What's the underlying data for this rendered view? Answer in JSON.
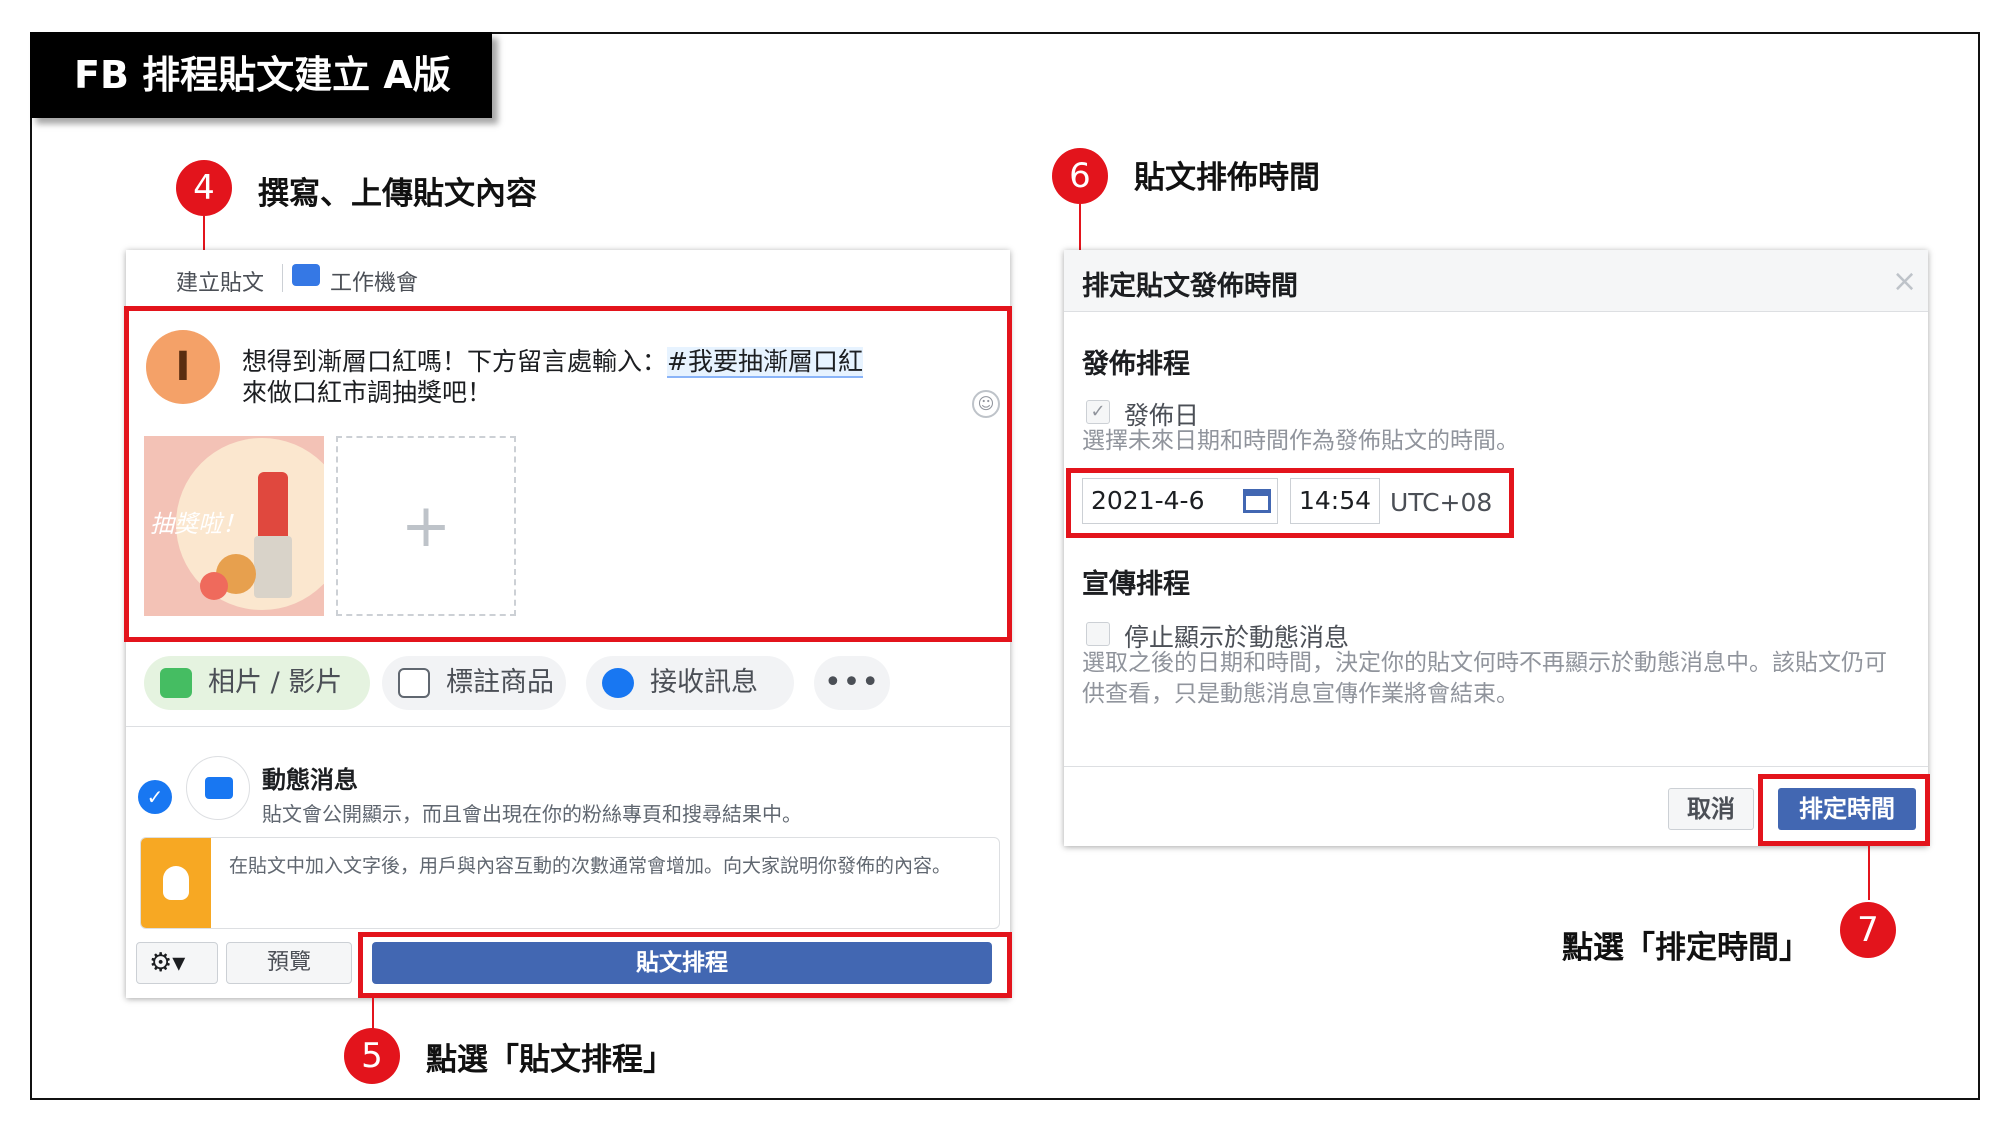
{
  "title": "FB 排程貼文建立 A版",
  "annotations": {
    "step4": {
      "number": "4",
      "text": "撰寫、上傳貼文內容"
    },
    "step5": {
      "number": "5",
      "text": "點選「貼文排程」"
    },
    "step6": {
      "number": "6",
      "text": "貼文排佈時間"
    },
    "step7": {
      "number": "7",
      "text": "點選「排定時間」"
    }
  },
  "composer": {
    "tabs": [
      "建立貼文",
      "工作機會"
    ],
    "avatar_initial": "I",
    "post_text": "想得到漸層口紅嗎！下方留言處輸入：",
    "post_hashtag": "#我要抽漸層口紅",
    "post_text_2": "來做口紅市調抽獎吧！",
    "image_text": "抽獎啦！",
    "add_media": "+",
    "actions": {
      "photos": "相片 / 影片",
      "tag_products": "標註商品",
      "messages": "接收訊息",
      "more": "•••"
    },
    "feed": {
      "title": "動態消息",
      "description": "貼文會公開顯示，而且會出現在你的粉絲專頁和搜尋結果中。"
    },
    "tip": "在貼文中加入文字後，用戶與內容互動的次數通常會增加。向大家說明你發佈的內容。",
    "buttons": {
      "gear": "⚙▾",
      "preview": "預覽",
      "schedule": "貼文排程"
    }
  },
  "dialog": {
    "title": "排定貼文發佈時間",
    "close": "×",
    "publish_section": "發佈排程",
    "publish_checkbox": "發佈日",
    "publish_hint": "選擇未來日期和時間作為發佈貼文的時間。",
    "date": "2021-4-6",
    "time": "14:54",
    "timezone": "UTC+08",
    "promo_section": "宣傳排程",
    "stop_checkbox": "停止顯示於動態消息",
    "stop_hint": "選取之後的日期和時間，決定你的貼文何時不再顯示於動態消息中。該貼文仍可供查看，只是動態消息宣傳作業將會結束。",
    "cancel": "取消",
    "confirm": "排定時間"
  },
  "colors": {
    "accent_red": "#e3141c",
    "fb_blue": "#4267b2"
  }
}
